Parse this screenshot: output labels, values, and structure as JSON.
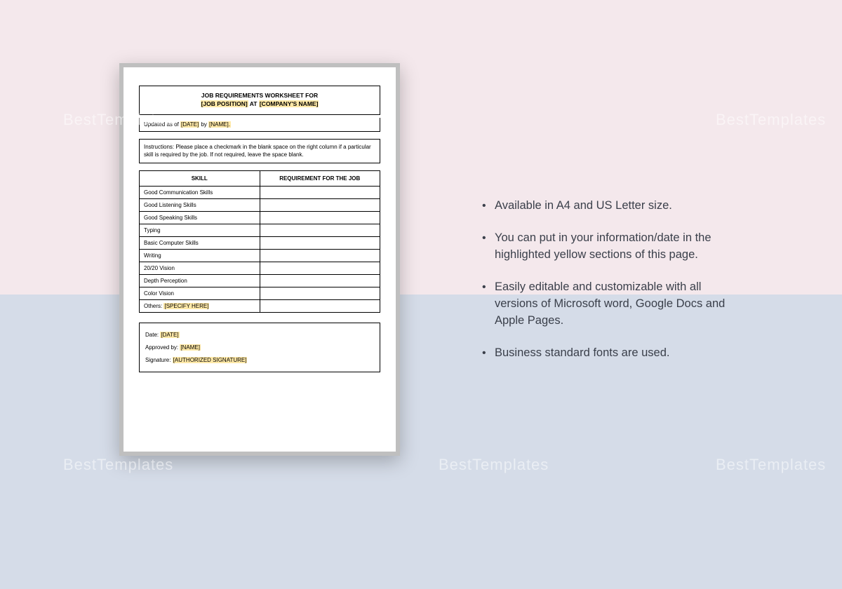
{
  "watermark": "BestTemplates",
  "doc": {
    "title_line1": "JOB REQUIREMENTS WORKSHEET FOR",
    "title_job": "[JOB POSITION]",
    "title_at": "AT",
    "title_company": "[COMPANY'S NAME]",
    "updated_prefix": "Updated as of",
    "updated_date": "[DATE]",
    "updated_by": "by",
    "updated_name": "[NAME].",
    "instructions": "Instructions: Please place a checkmark in the blank space on the right column if a particular skill is required by the job. If not required, leave the space blank.",
    "col_skill": "SKILL",
    "col_req": "REQUIREMENT FOR THE JOB",
    "skills": [
      "Good Communication Skills",
      "Good Listening Skills",
      "Good Speaking Skills",
      "Typing",
      "Basic Computer Skills",
      "Writing",
      "20/20 Vision",
      "Depth Perception",
      "Color Vision"
    ],
    "others_label": "Others:",
    "others_ph": "[SPECIFY HERE]",
    "sig_date_label": "Date:",
    "sig_date_ph": "[DATE]",
    "sig_approved_label": "Approved by:",
    "sig_approved_ph": "[NAME]",
    "sig_sign_label": "Signature:",
    "sig_sign_ph": "[AUTHORIZED SIGNATURE]"
  },
  "features": [
    "Available in A4 and US Letter size.",
    "You can put in your information/date in the highlighted yellow sections of this page.",
    "Easily editable and customizable with all versions of Microsoft word, Google Docs and Apple Pages.",
    "Business standard fonts are used."
  ]
}
